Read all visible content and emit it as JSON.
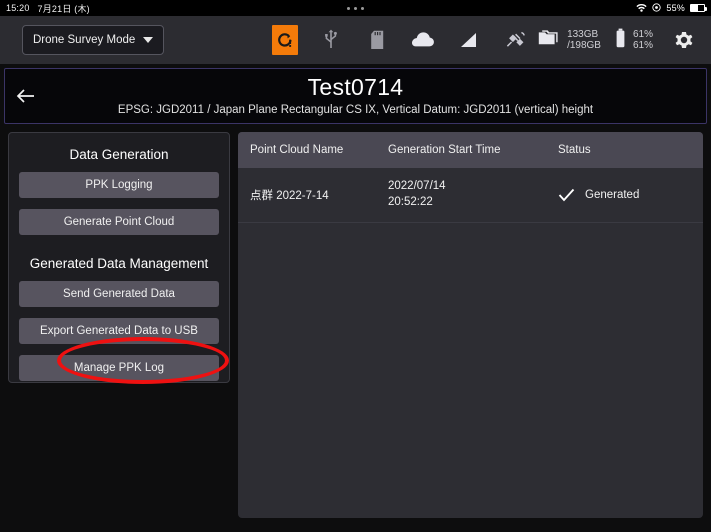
{
  "statusbar": {
    "time": "15:20",
    "date": "7月21日 (木)",
    "wifi_icon": "wifi-icon",
    "location_icon": "location-icon",
    "battery_percent": "55%",
    "battery_icon": "battery-icon",
    "dots_indicator": "notification-dots"
  },
  "toolbar": {
    "mode_label": "Drone Survey Mode",
    "mode_caret": "chevron-down-icon",
    "icons": [
      {
        "name": "sync-warning-icon",
        "accent": "#f47b0a"
      },
      {
        "name": "usb-icon"
      },
      {
        "name": "sd-card-icon"
      },
      {
        "name": "cloud-icon"
      },
      {
        "name": "signal-strength-icon"
      },
      {
        "name": "satellite-icon"
      }
    ],
    "storage": {
      "icon": "folder-icon",
      "used": "133GB",
      "total": "/198GB"
    },
    "battery": {
      "icon": "battery-icon",
      "line1": "61%",
      "line2": "61%"
    },
    "settings_icon": "gear-icon"
  },
  "header": {
    "back_icon": "back-arrow-icon",
    "title": "Test0714",
    "subtitle": "EPSG: JGD2011 / Japan Plane Rectangular CS IX, Vertical Datum: JGD2011 (vertical) height",
    "border_color": "#3b3466"
  },
  "sidebar": {
    "section_data_generation": "Data Generation",
    "buttons_data_generation": [
      {
        "label": "PPK Logging"
      },
      {
        "label": "Generate Point Cloud"
      }
    ],
    "section_generated_data": "Generated Data Management",
    "buttons_generated_data": [
      {
        "label": "Send Generated Data"
      },
      {
        "label": "Export Generated Data to USB"
      },
      {
        "label": "Manage PPK Log"
      }
    ]
  },
  "table": {
    "columns": {
      "name": "Point Cloud Name",
      "time": "Generation Start Time",
      "status": "Status"
    },
    "rows": [
      {
        "name": "点群 2022-7-14",
        "time_date": "2022/07/14",
        "time_clock": "20:52:22",
        "status_icon": "check-icon",
        "status": "Generated"
      }
    ]
  },
  "annotation": {
    "name": "red-highlight-ellipse",
    "color": "#ee1111",
    "targets": "Manage PPK Log"
  }
}
